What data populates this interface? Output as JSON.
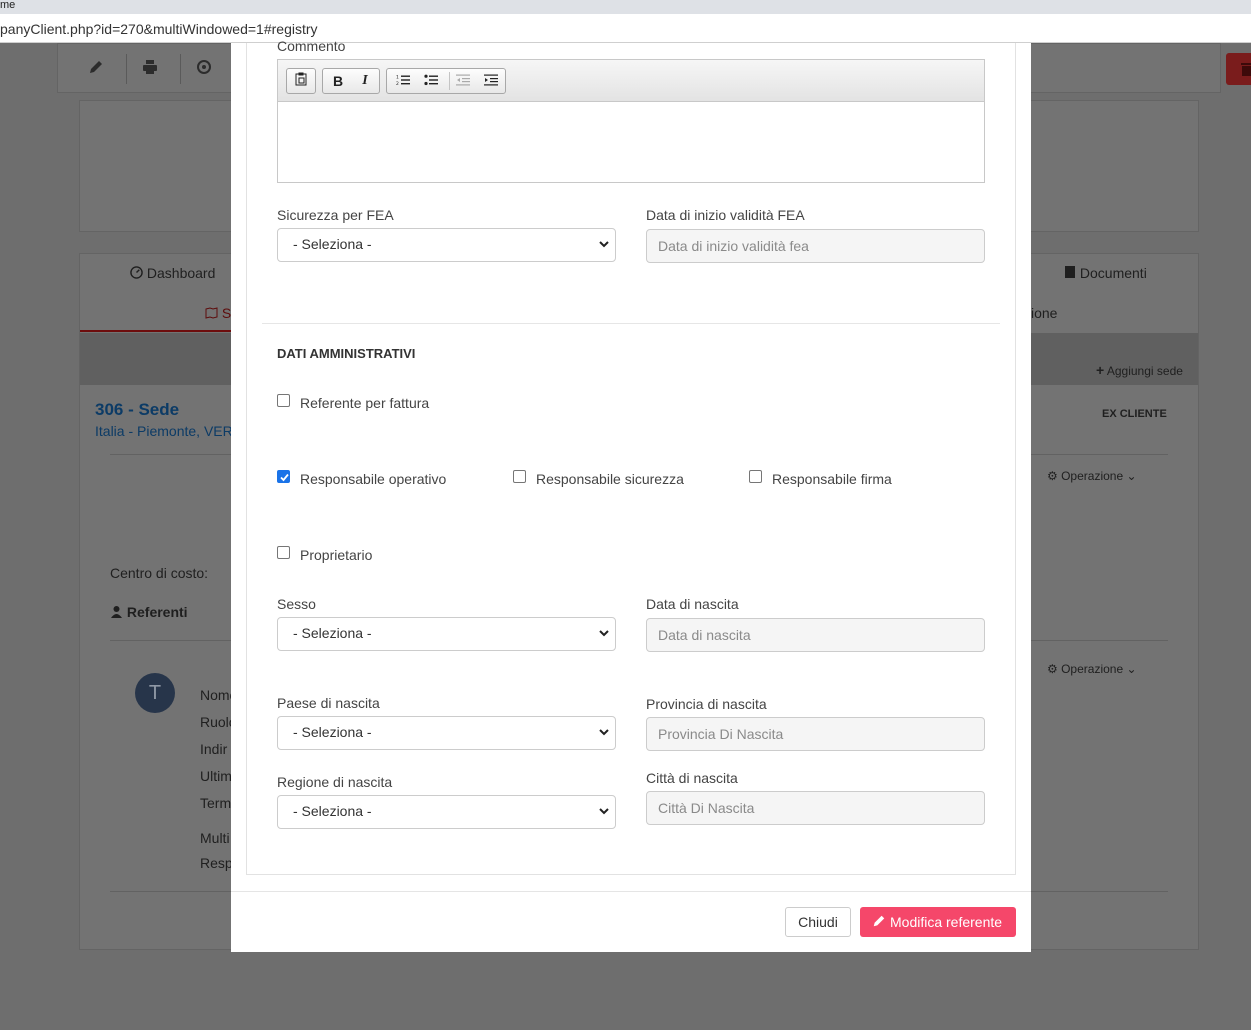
{
  "browser": {
    "title_fragment": "me",
    "url_fragment": "panyClient.php?id=270&multiWindowed=1#registry"
  },
  "background": {
    "tabs": {
      "dashboard": "Dashboard",
      "documenti": "Documenti",
      "sedi_fragment": "S",
      "zione_fragment": "ione"
    },
    "add_sede": "Aggiungi sede",
    "sede_title": "306 - Sede",
    "sede_address": "Italia - Piemonte, VER",
    "ex_cliente": "EX CLIENTE",
    "operazione": "Operazione",
    "centro_costo": "Centro di costo:",
    "referenti": "Referenti",
    "avatar_initial": "T",
    "referent_fields": [
      "Nome",
      "Ruolo",
      "Indir",
      "Ultim",
      "Term",
      "Multi",
      "Resp"
    ]
  },
  "modal": {
    "commento_label": "Commento",
    "sicurezza_fea": {
      "label": "Sicurezza per FEA",
      "value": "- Seleziona -"
    },
    "data_inizio_fea": {
      "label": "Data di inizio validità FEA",
      "placeholder": "Data di inizio validità fea"
    },
    "section_title": "DATI AMMINISTRATIVI",
    "checkboxes": {
      "referente_fattura": {
        "label": "Referente per fattura",
        "checked": false
      },
      "responsabile_operativo": {
        "label": "Responsabile operativo",
        "checked": true
      },
      "responsabile_sicurezza": {
        "label": "Responsabile sicurezza",
        "checked": false
      },
      "responsabile_firma": {
        "label": "Responsabile firma",
        "checked": false
      },
      "proprietario": {
        "label": "Proprietario",
        "checked": false
      }
    },
    "sesso": {
      "label": "Sesso",
      "value": "- Seleziona -"
    },
    "data_nascita": {
      "label": "Data di nascita",
      "placeholder": "Data di nascita"
    },
    "paese_nascita": {
      "label": "Paese di nascita",
      "value": "- Seleziona -"
    },
    "provincia_nascita": {
      "label": "Provincia di nascita",
      "placeholder": "Provincia Di Nascita"
    },
    "regione_nascita": {
      "label": "Regione di nascita",
      "value": "- Seleziona -"
    },
    "citta_nascita": {
      "label": "Città di nascita",
      "placeholder": "Città Di Nascita"
    },
    "buttons": {
      "close": "Chiudi",
      "submit": "Modifica referente"
    }
  },
  "colors": {
    "primary": "#f5476a",
    "checkbox": "#1a73e8",
    "overlay": "#6e6e6e"
  }
}
